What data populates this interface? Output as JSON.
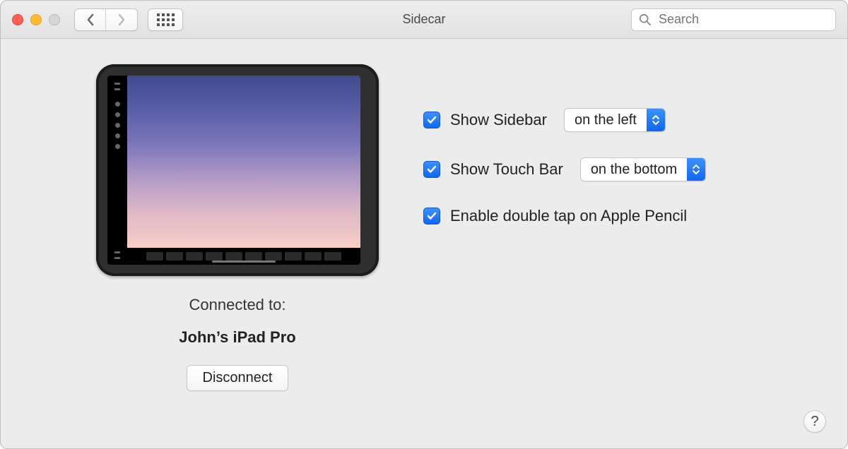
{
  "window": {
    "title": "Sidecar",
    "search_placeholder": "Search"
  },
  "left": {
    "connected_label": "Connected to:",
    "device_name": "John’s iPad Pro",
    "disconnect_label": "Disconnect"
  },
  "options": {
    "sidebar": {
      "checked": true,
      "label": "Show Sidebar",
      "popup_value": "on the left"
    },
    "touchbar": {
      "checked": true,
      "label": "Show Touch Bar",
      "popup_value": "on the bottom"
    },
    "pencil": {
      "checked": true,
      "label": "Enable double tap on Apple Pencil"
    }
  },
  "help_label": "?"
}
